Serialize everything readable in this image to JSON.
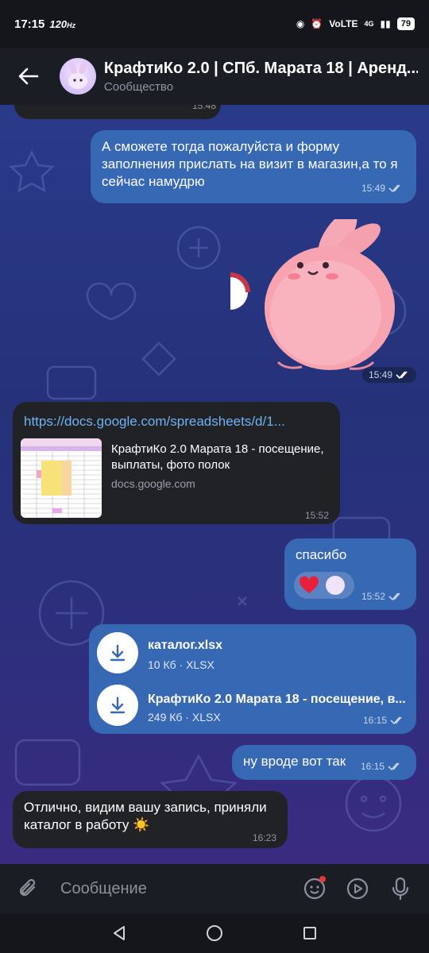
{
  "status": {
    "time": "17:15",
    "refresh": "120",
    "refresh_unit": "Hz",
    "network": "VoLTE",
    "cell": "4G",
    "battery": "79"
  },
  "header": {
    "title": "КрафтиКо 2.0 | СПб. Марата 18 | Аренд...",
    "subtitle": "Сообщество"
  },
  "messages": {
    "m1": {
      "text": "А сможете тогда пожалуйста и форму заполнения прислать на визит в магазин,а то я сейчас намудрю",
      "time": "15:49"
    },
    "sticker": {
      "time": "15:49"
    },
    "link": {
      "url": "https://docs.google.com/spreadsheets/d/1...",
      "title": "КрафтиКо 2.0 Марата 18 - посещение, выплаты, фото полок",
      "site": "docs.google.com",
      "time": "15:52"
    },
    "thanks": {
      "text": "спасибо",
      "time": "15:52"
    },
    "files": {
      "f1": {
        "name": "каталог.xlsx",
        "size": "10 Кб · XLSX"
      },
      "f2": {
        "name": "КрафтиКо 2.0 Марата 18 - посещение, в...",
        "size": "249 Кб · XLSX"
      },
      "time": "16:15"
    },
    "m5": {
      "text": "ну вроде вот так",
      "time": "16:15"
    },
    "m6": {
      "text": "Отлично, видим вашу запись, приняли каталог в работу ☀️",
      "time": "16:23"
    },
    "prev_time": "15:48"
  },
  "input": {
    "placeholder": "Сообщение"
  },
  "colors": {
    "outgoing_bubble": "#3768b4",
    "incoming_bubble": "#212226",
    "link": "#6fb3f4"
  }
}
